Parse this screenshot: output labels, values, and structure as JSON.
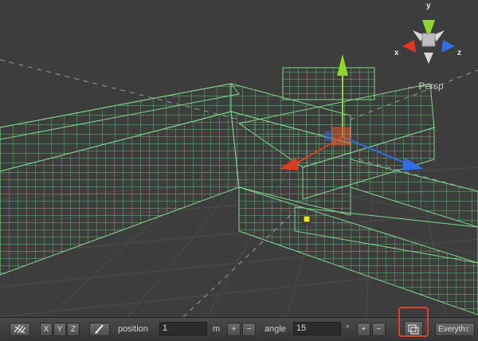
{
  "viewport": {
    "projection_label": "← Persp",
    "gizmo": {
      "axis_x": "x",
      "axis_y": "y",
      "axis_z": "z"
    }
  },
  "toolbar": {
    "grid_icon": "grid-snap-icon",
    "axis_x": "X",
    "axis_y": "Y",
    "axis_z": "Z",
    "brush_icon": "brush-tool-icon",
    "position_label": "position",
    "position_value": "1",
    "position_unit": "m",
    "plus": "+",
    "minus": "−",
    "angle_label": "angle",
    "angle_value": "15",
    "angle_unit": "°",
    "snap_icon": "snap-copy-icon",
    "layer_dropdown": "Everyth↕"
  },
  "colors": {
    "wireframe": "#7ed98a",
    "gizmo_x": "#e03a1e",
    "gizmo_y": "#8ed629",
    "gizmo_z": "#2e6ee8",
    "highlight": "#e0402a",
    "selection_point": "#f2e60a"
  }
}
